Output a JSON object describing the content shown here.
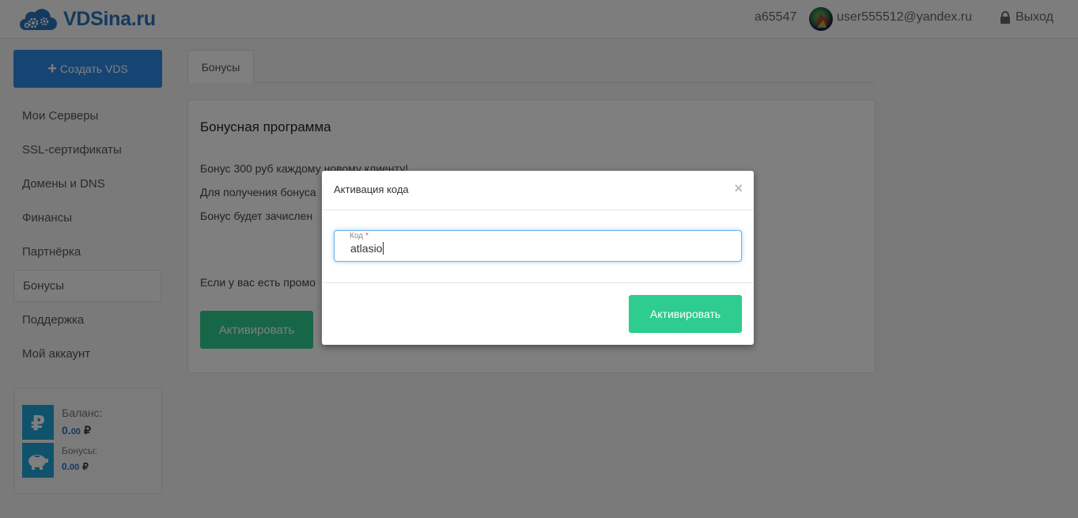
{
  "header": {
    "logo_text": "VDSina.ru",
    "account_id": "a65547",
    "user_email": "user555512@yandex.ru",
    "logout_label": "Выход"
  },
  "sidebar": {
    "create_label": "Создать VDS",
    "items": [
      {
        "label": "Мои Серверы"
      },
      {
        "label": "SSL-сертификаты"
      },
      {
        "label": "Домены и DNS"
      },
      {
        "label": "Финансы"
      },
      {
        "label": "Партнёрка"
      },
      {
        "label": "Бонусы",
        "active": true
      },
      {
        "label": "Поддержка"
      },
      {
        "label": "Мой аккаунт"
      }
    ],
    "balance": {
      "balance_label": "Баланс:",
      "balance_int": "0.",
      "balance_dec": "00",
      "currency": "₽",
      "bonus_label": "Бонусы:",
      "bonus_int": "0.",
      "bonus_dec": "00"
    }
  },
  "main": {
    "tab_label": "Бонусы",
    "panel_title": "Бонусная программа",
    "lines": [
      "Бонус 300 руб каждому новому клиенту!",
      "Для получения бонуса",
      "Бонус будет зачислен",
      "Если у вас есть промо"
    ],
    "button_label": "Активировать"
  },
  "modal": {
    "title": "Активация кода",
    "close_glyph": "×",
    "field_label": "Код",
    "required_mark": "*",
    "field_value": "atlasio",
    "button_label": "Активировать"
  },
  "colors": {
    "brand": "#2a73bf",
    "primary_button": "#2e8ae6",
    "success_button": "#2ecc8f",
    "info_icon_bg": "#20a4d9"
  },
  "icons": [
    "cloud-gears-logo-icon",
    "avatar-image",
    "lock-icon",
    "plus-icon",
    "ruble-icon",
    "piggy-bank-icon",
    "close-icon"
  ]
}
